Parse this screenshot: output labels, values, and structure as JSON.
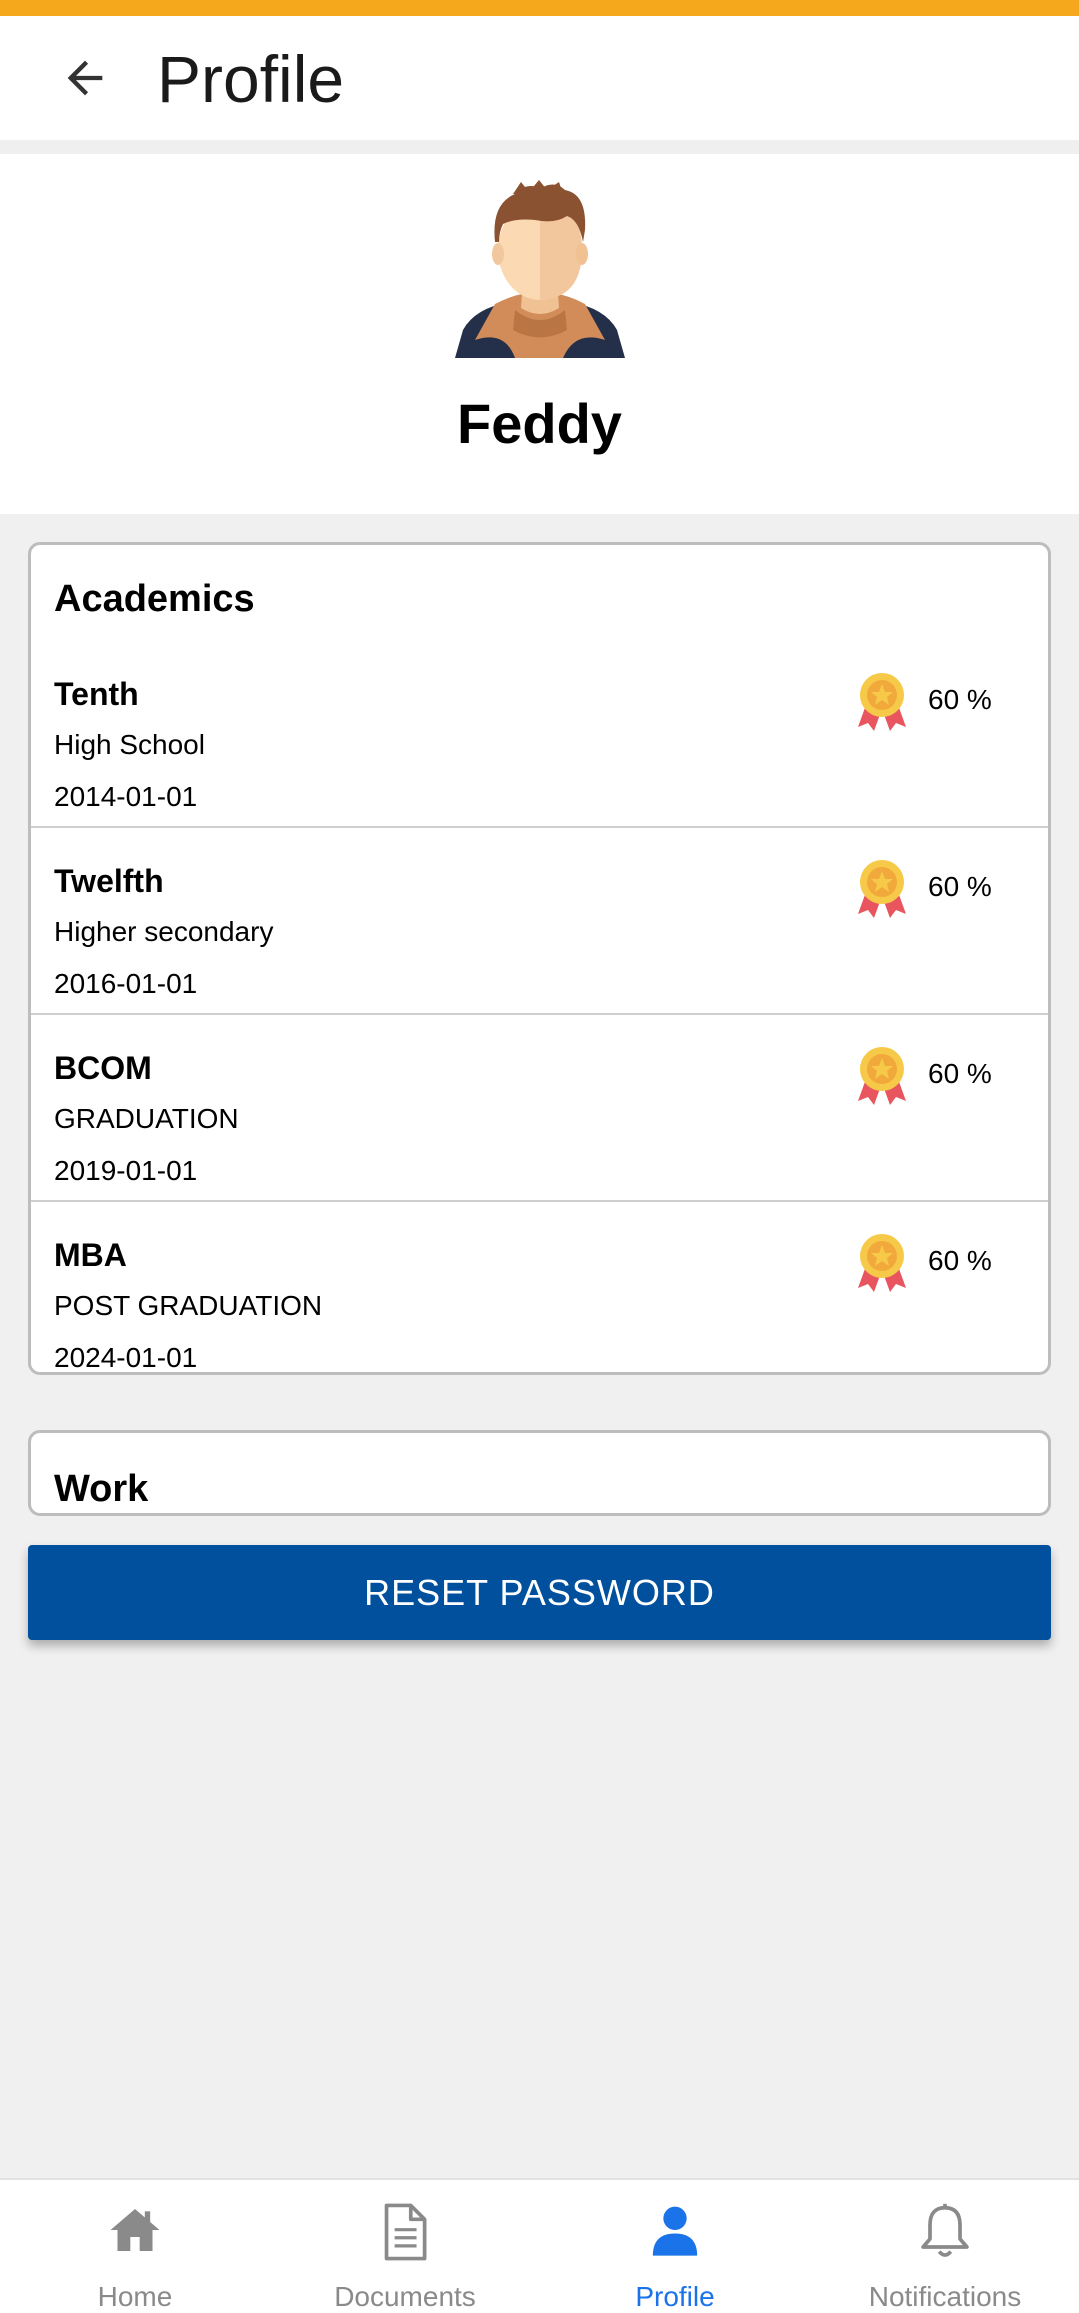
{
  "header": {
    "title": "Profile"
  },
  "profile": {
    "name": "Feddy"
  },
  "academics": {
    "title": "Academics",
    "items": [
      {
        "degree": "Tenth",
        "level": "High School",
        "date": "2014-01-01",
        "percent": "60 %"
      },
      {
        "degree": "Twelfth",
        "level": "Higher secondary",
        "date": "2016-01-01",
        "percent": "60 %"
      },
      {
        "degree": "BCOM",
        "level": "GRADUATION",
        "date": "2019-01-01",
        "percent": "60 %"
      },
      {
        "degree": "MBA",
        "level": "POST GRADUATION",
        "date": "2024-01-01",
        "percent": "60 %"
      }
    ]
  },
  "work": {
    "title": "Work"
  },
  "actions": {
    "reset_password_label": "RESET PASSWORD"
  },
  "bottom_nav": {
    "items": [
      {
        "label": "Home",
        "icon": "home-icon"
      },
      {
        "label": "Documents",
        "icon": "document-icon"
      },
      {
        "label": "Profile",
        "icon": "user-icon",
        "active": true
      },
      {
        "label": "Notifications",
        "icon": "bell-icon"
      }
    ]
  },
  "colors": {
    "accent_stripe": "#f5a81c",
    "primary_button": "#00509e",
    "active_nav": "#1a73e8",
    "inactive_nav": "#8a8a8a"
  }
}
